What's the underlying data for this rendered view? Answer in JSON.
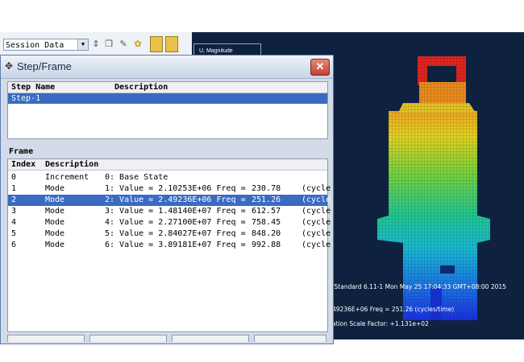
{
  "toolbar": {
    "session_value": "Session Data"
  },
  "viewport": {
    "legend_title": "U, Magnitude",
    "info_line": "/Standard 6.11-1   Mon May 25 17:04:33 GMT+08:00 2015",
    "mode_line": "49236E+06 Freq =    251.26    (cycles/time)",
    "scale_line": "ation Scale Factor: +1.131e+02"
  },
  "dialog": {
    "title": "Step/Frame",
    "steps": {
      "headers": [
        "Step Name",
        "Description"
      ],
      "rows": [
        {
          "name": "Step-1",
          "description": "",
          "selected": true
        }
      ]
    },
    "frame_label": "Frame",
    "frames": {
      "headers": [
        "Index",
        "Description"
      ],
      "rows": [
        {
          "index": "0",
          "type": "Increment",
          "desc": "0: Base State",
          "freq": "",
          "tail": "",
          "selected": false
        },
        {
          "index": "1",
          "type": "Mode",
          "desc": "1: Value =  2.10253E+06 Freq =",
          "freq": "230.78",
          "tail": "(cycle",
          "selected": false
        },
        {
          "index": "2",
          "type": "Mode",
          "desc": "2: Value =  2.49236E+06 Freq =",
          "freq": "251.26",
          "tail": "(cycle",
          "selected": true
        },
        {
          "index": "3",
          "type": "Mode",
          "desc": "3: Value =  1.48140E+07 Freq =",
          "freq": "612.57",
          "tail": "(cycle",
          "selected": false
        },
        {
          "index": "4",
          "type": "Mode",
          "desc": "4: Value =  2.27100E+07 Freq =",
          "freq": "758.45",
          "tail": "(cycle",
          "selected": false
        },
        {
          "index": "5",
          "type": "Mode",
          "desc": "5: Value =  2.84027E+07 Freq =",
          "freq": "848.20",
          "tail": "(cycle",
          "selected": false
        },
        {
          "index": "6",
          "type": "Mode",
          "desc": "6: Value =  3.89181E+07 Freq =",
          "freq": "992.88",
          "tail": "(cycle",
          "selected": false
        }
      ]
    }
  }
}
